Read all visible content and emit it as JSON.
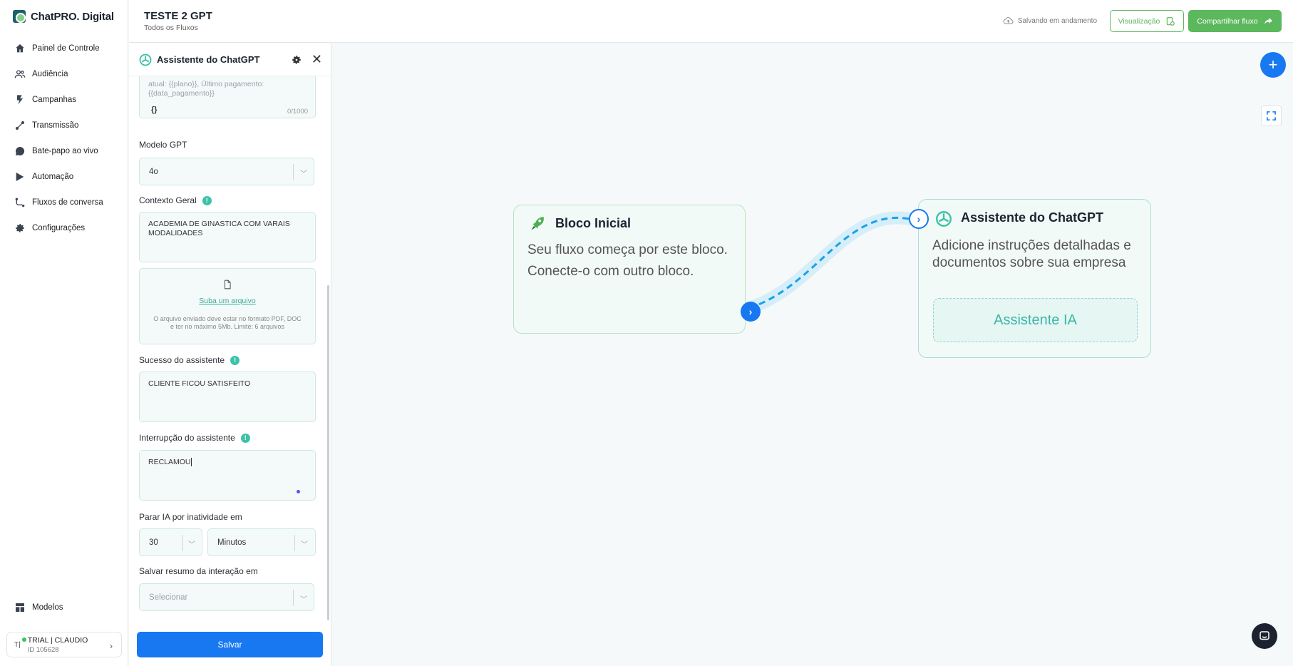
{
  "brand": {
    "name": "ChatPRO. Digital"
  },
  "sidebar": {
    "items": [
      {
        "label": "Painel de Controle",
        "icon": "home-icon"
      },
      {
        "label": "Audiência",
        "icon": "users-icon"
      },
      {
        "label": "Campanhas",
        "icon": "bolt-icon"
      },
      {
        "label": "Transmissão",
        "icon": "broadcast-icon"
      },
      {
        "label": "Bate-papo ao vivo",
        "icon": "chat-icon"
      },
      {
        "label": "Automação",
        "icon": "automation-icon"
      },
      {
        "label": "Fluxos de conversa",
        "icon": "flow-icon"
      },
      {
        "label": "Configurações",
        "icon": "gear-icon"
      }
    ],
    "bottom_item": {
      "label": "Modelos",
      "icon": "templates-icon"
    },
    "user": {
      "initials": "T|",
      "name": "TRIAL | CLAUDIO",
      "id": "ID 105628"
    }
  },
  "header": {
    "title": "TESTE 2 GPT",
    "subtitle": "Todos os Fluxos",
    "saving_status": "Salvando em andamento",
    "preview_label": "Visualização",
    "share_label": "Compartilhar fluxo"
  },
  "panel": {
    "title": "Assistente do ChatGPT",
    "instructions": {
      "placeholder_text": "atual: {{plano}}, Último pagamento: {{data_pagamento}}",
      "vars_button": "{}",
      "counter": "0/1000"
    },
    "model": {
      "label": "Modelo GPT",
      "value": "4o"
    },
    "context": {
      "label": "Contexto Geral",
      "value": "ACADEMIA DE GINASTICA COM VARAIS MODALIDADES"
    },
    "upload": {
      "link": "Suba um arquivo",
      "hint": "O arquivo enviado deve estar no formato PDF, DOC e ter no máximo 5Mb. Limite: 6 arquivos"
    },
    "success": {
      "label": "Sucesso do assistente",
      "value": "CLIENTE FICOU SATISFEITO"
    },
    "interruption": {
      "label": "Interrupção do assistente",
      "value": "RECLAMOU"
    },
    "inactivity": {
      "label": "Parar IA por inatividade em",
      "amount": "30",
      "unit": "Minutos"
    },
    "summary": {
      "label": "Salvar resumo da interação em",
      "placeholder": "Selecionar"
    },
    "save_label": "Salvar"
  },
  "canvas": {
    "start_node": {
      "title": "Bloco Inicial",
      "text_line1": "Seu fluxo começa por este bloco.",
      "text_line2": "Conecte-o com outro bloco."
    },
    "gpt_node": {
      "title": "Assistente do ChatGPT",
      "text": "Adicione instruções detalhadas e documentos sobre sua empresa",
      "button": "Assistente IA"
    }
  },
  "colors": {
    "primary": "#1778f2",
    "green": "#5cb85c",
    "teal": "#3cc2a7"
  }
}
